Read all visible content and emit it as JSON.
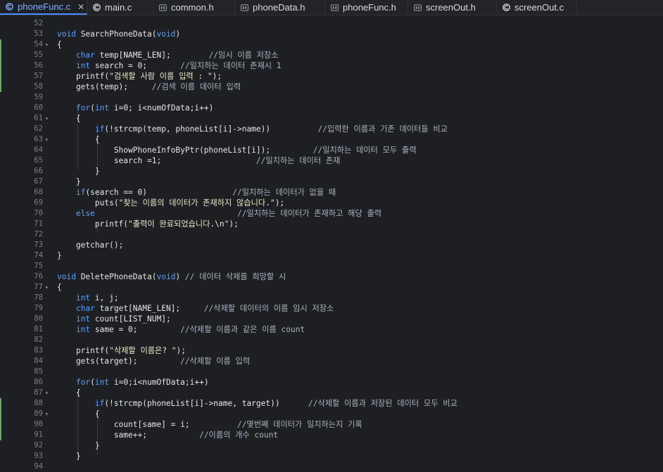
{
  "tabs": [
    {
      "label": "phoneFunc.c",
      "icon": "c-file-icon",
      "active": true,
      "closable": true
    },
    {
      "label": "main.c",
      "icon": "c-file-icon",
      "active": false,
      "closable": false
    },
    {
      "label": "common.h",
      "icon": "header-file-icon",
      "active": false,
      "closable": false
    },
    {
      "label": "phoneData.h",
      "icon": "header-file-icon",
      "active": false,
      "closable": false
    },
    {
      "label": "phoneFunc.h",
      "icon": "header-file-icon",
      "active": false,
      "closable": false
    },
    {
      "label": "screenOut.h",
      "icon": "header-file-icon",
      "active": false,
      "closable": false
    },
    {
      "label": "screenOut.c",
      "icon": "c-file-icon",
      "active": false,
      "closable": false
    }
  ],
  "colors": {
    "background": "#1e1f22",
    "keyword": "#5aa0ff",
    "string": "#e9e9c9",
    "comment": "#a9b3c1",
    "active_tab": "#7fb0ff",
    "changed_line_marker": "#6aa66a"
  },
  "lines": [
    {
      "n": "52",
      "fold": false,
      "mark": false,
      "parts": []
    },
    {
      "n": "53",
      "fold": false,
      "mark": false,
      "parts": [
        [
          "kw",
          "void"
        ],
        [
          "p",
          " SearchPhoneData("
        ],
        [
          "kw",
          "void"
        ],
        [
          "p",
          ")"
        ]
      ]
    },
    {
      "n": "54",
      "fold": true,
      "mark": true,
      "parts": [
        [
          "p",
          "{"
        ]
      ]
    },
    {
      "n": "55",
      "fold": false,
      "mark": true,
      "parts": [
        [
          "p",
          "    "
        ],
        [
          "kw",
          "char"
        ],
        [
          "p",
          " temp[NAME_LEN];        "
        ],
        [
          "cm",
          "//임시 이름 저장소"
        ]
      ]
    },
    {
      "n": "56",
      "fold": false,
      "mark": true,
      "parts": [
        [
          "p",
          "    "
        ],
        [
          "kw",
          "int"
        ],
        [
          "p",
          " search = 0;       "
        ],
        [
          "cm",
          "//일치하는 데이터 존재시 1"
        ]
      ]
    },
    {
      "n": "57",
      "fold": false,
      "mark": true,
      "parts": [
        [
          "p",
          "    printf("
        ],
        [
          "str",
          "\"검색할 사람 이름 입력 : \""
        ],
        [
          "p",
          ");"
        ]
      ]
    },
    {
      "n": "58",
      "fold": false,
      "mark": true,
      "parts": [
        [
          "p",
          "    gets(temp);     "
        ],
        [
          "cm",
          "//검색 이름 데이터 입력"
        ]
      ]
    },
    {
      "n": "59",
      "fold": false,
      "mark": false,
      "parts": []
    },
    {
      "n": "60",
      "fold": false,
      "mark": false,
      "parts": [
        [
          "p",
          "    "
        ],
        [
          "kw",
          "for"
        ],
        [
          "p",
          "("
        ],
        [
          "kw",
          "int"
        ],
        [
          "p",
          " i=0; i<numOfData;i++)"
        ]
      ]
    },
    {
      "n": "61",
      "fold": true,
      "mark": false,
      "parts": [
        [
          "p",
          "    {"
        ]
      ]
    },
    {
      "n": "62",
      "fold": false,
      "mark": false,
      "parts": [
        [
          "p",
          "        "
        ],
        [
          "kw",
          "if"
        ],
        [
          "p",
          "(!strcmp(temp, phoneList[i]->name))          "
        ],
        [
          "cm",
          "//입력한 이름과 기존 데이터들 비교"
        ]
      ]
    },
    {
      "n": "63",
      "fold": true,
      "mark": false,
      "parts": [
        [
          "p",
          "        {"
        ]
      ]
    },
    {
      "n": "64",
      "fold": false,
      "mark": false,
      "parts": [
        [
          "p",
          "            ShowPhoneInfoByPtr(phoneList[i]);         "
        ],
        [
          "cm",
          "//일치하는 데이터 모두 출력"
        ]
      ]
    },
    {
      "n": "65",
      "fold": false,
      "mark": false,
      "parts": [
        [
          "p",
          "            search =1;                    "
        ],
        [
          "cm",
          "//일치하는 데이터 존재"
        ]
      ]
    },
    {
      "n": "66",
      "fold": false,
      "mark": false,
      "parts": [
        [
          "p",
          "        }"
        ]
      ]
    },
    {
      "n": "67",
      "fold": false,
      "mark": false,
      "parts": [
        [
          "p",
          "    }"
        ]
      ]
    },
    {
      "n": "68",
      "fold": false,
      "mark": false,
      "parts": [
        [
          "p",
          "    "
        ],
        [
          "kw",
          "if"
        ],
        [
          "p",
          "(search == 0)                  "
        ],
        [
          "cm",
          "//일치하는 데이터가 없을 때"
        ]
      ]
    },
    {
      "n": "69",
      "fold": false,
      "mark": false,
      "parts": [
        [
          "p",
          "        puts("
        ],
        [
          "str",
          "\"찾는 이름의 데이터가 존재하지 않습니다.\""
        ],
        [
          "p",
          ");"
        ]
      ]
    },
    {
      "n": "70",
      "fold": false,
      "mark": false,
      "parts": [
        [
          "p",
          "    "
        ],
        [
          "kw",
          "else"
        ],
        [
          "p",
          "                              "
        ],
        [
          "cm",
          "//일치하는 데이터가 존재하고 해당 출력"
        ]
      ]
    },
    {
      "n": "71",
      "fold": false,
      "mark": false,
      "parts": [
        [
          "p",
          "        printf("
        ],
        [
          "str",
          "\"출력이 완료되었습니다.\\n\""
        ],
        [
          "p",
          ");"
        ]
      ]
    },
    {
      "n": "72",
      "fold": false,
      "mark": false,
      "parts": []
    },
    {
      "n": "73",
      "fold": false,
      "mark": false,
      "parts": [
        [
          "p",
          "    getchar();"
        ]
      ]
    },
    {
      "n": "74",
      "fold": false,
      "mark": false,
      "parts": [
        [
          "p",
          "}"
        ]
      ]
    },
    {
      "n": "75",
      "fold": false,
      "mark": false,
      "parts": []
    },
    {
      "n": "76",
      "fold": false,
      "mark": false,
      "parts": [
        [
          "kw",
          "void"
        ],
        [
          "p",
          " DeletePhoneData("
        ],
        [
          "kw",
          "void"
        ],
        [
          "p",
          ") "
        ],
        [
          "cm",
          "// 데이터 삭제를 희망할 시"
        ]
      ]
    },
    {
      "n": "77",
      "fold": true,
      "mark": false,
      "parts": [
        [
          "p",
          "{"
        ]
      ]
    },
    {
      "n": "78",
      "fold": false,
      "mark": false,
      "parts": [
        [
          "p",
          "    "
        ],
        [
          "kw",
          "int"
        ],
        [
          "p",
          " i, j;"
        ]
      ]
    },
    {
      "n": "79",
      "fold": false,
      "mark": false,
      "parts": [
        [
          "p",
          "    "
        ],
        [
          "kw",
          "char"
        ],
        [
          "p",
          " target[NAME_LEN];     "
        ],
        [
          "cm",
          "//삭제할 데이터의 이름 임시 저장소"
        ]
      ]
    },
    {
      "n": "80",
      "fold": false,
      "mark": false,
      "parts": [
        [
          "p",
          "    "
        ],
        [
          "kw",
          "int"
        ],
        [
          "p",
          " count[LIST_NUM];"
        ]
      ]
    },
    {
      "n": "81",
      "fold": false,
      "mark": false,
      "parts": [
        [
          "p",
          "    "
        ],
        [
          "kw",
          "int"
        ],
        [
          "p",
          " same = 0;         "
        ],
        [
          "cm",
          "//삭제할 이름과 같은 이름 count"
        ]
      ]
    },
    {
      "n": "82",
      "fold": false,
      "mark": false,
      "parts": []
    },
    {
      "n": "83",
      "fold": false,
      "mark": false,
      "parts": [
        [
          "p",
          "    printf("
        ],
        [
          "str",
          "\"삭제할 이름은? \""
        ],
        [
          "p",
          ");"
        ]
      ]
    },
    {
      "n": "84",
      "fold": false,
      "mark": false,
      "parts": [
        [
          "p",
          "    gets(target);         "
        ],
        [
          "cm",
          "//삭제할 이름 입력"
        ]
      ]
    },
    {
      "n": "85",
      "fold": false,
      "mark": false,
      "parts": []
    },
    {
      "n": "86",
      "fold": false,
      "mark": false,
      "parts": [
        [
          "p",
          "    "
        ],
        [
          "kw",
          "for"
        ],
        [
          "p",
          "("
        ],
        [
          "kw",
          "int"
        ],
        [
          "p",
          " i=0;i<numOfData;i++)"
        ]
      ]
    },
    {
      "n": "87",
      "fold": true,
      "mark": false,
      "parts": [
        [
          "p",
          "    {"
        ]
      ]
    },
    {
      "n": "88",
      "fold": false,
      "mark": true,
      "parts": [
        [
          "p",
          "        "
        ],
        [
          "kw",
          "if"
        ],
        [
          "p",
          "(!strcmp(phoneList[i]->name, target))      "
        ],
        [
          "cm",
          "//삭제할 이름과 저장된 데이터 모두 비교"
        ]
      ]
    },
    {
      "n": "89",
      "fold": true,
      "mark": true,
      "parts": [
        [
          "p",
          "        {"
        ]
      ]
    },
    {
      "n": "90",
      "fold": false,
      "mark": true,
      "parts": [
        [
          "p",
          "            count[same] = i;          "
        ],
        [
          "cm",
          "//몇번째 데이터가 일치하는지 기록"
        ]
      ]
    },
    {
      "n": "91",
      "fold": false,
      "mark": true,
      "parts": [
        [
          "p",
          "            same++;           "
        ],
        [
          "cm",
          "//이름의 개수 count"
        ]
      ]
    },
    {
      "n": "92",
      "fold": false,
      "mark": false,
      "parts": [
        [
          "p",
          "        }"
        ]
      ]
    },
    {
      "n": "93",
      "fold": false,
      "mark": false,
      "parts": [
        [
          "p",
          "    }"
        ]
      ]
    },
    {
      "n": "94",
      "fold": false,
      "mark": false,
      "parts": []
    }
  ]
}
